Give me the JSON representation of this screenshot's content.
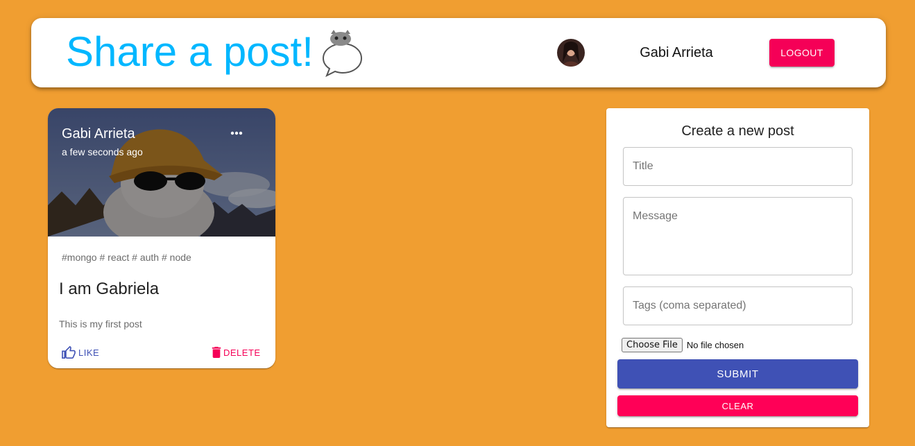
{
  "header": {
    "brand_title": "Share a post!",
    "logo_icon": "speech-bubble-cat-icon",
    "user_name": "Gabi Arrieta",
    "avatar_icon": "user-avatar",
    "logout_label": "LOGOUT"
  },
  "posts": [
    {
      "author": "Gabi Arrieta",
      "time": "a few seconds ago",
      "tags": "#mongo # react # auth # node",
      "title": "I am Gabriela",
      "message": "This is my first post",
      "like_label": "LIKE",
      "delete_label": "DELETE",
      "image_icon": "cat-with-hat-photo"
    }
  ],
  "form": {
    "heading": "Create a new post",
    "title_placeholder": "Title",
    "message_placeholder": "Message",
    "tags_placeholder": "Tags (coma separated)",
    "file_button_label": "Choose File",
    "file_status": "No file chosen",
    "submit_label": "SUBMIT",
    "clear_label": "CLEAR"
  },
  "colors": {
    "background": "#f09e31",
    "brand": "#00b7ff",
    "primary": "#3f51b5",
    "secondary": "#f50057"
  }
}
